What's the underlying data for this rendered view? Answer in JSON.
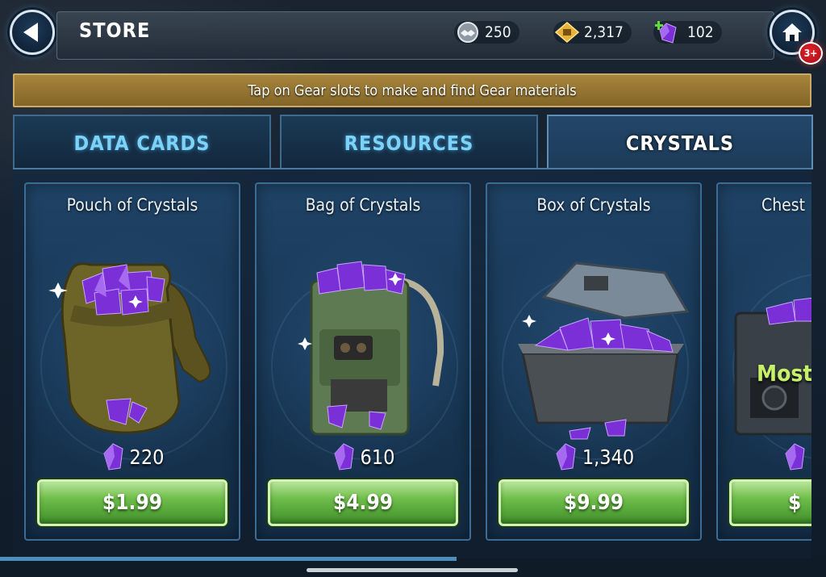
{
  "header": {
    "title": "STORE",
    "currencies": [
      {
        "name": "ally-points",
        "icon": "handshake-icon",
        "value": "250"
      },
      {
        "name": "credits",
        "icon": "credits-icon",
        "value": "2,317"
      },
      {
        "name": "crystals",
        "icon": "crystal-plus-icon",
        "value": "102"
      }
    ],
    "notification_badge": "3+"
  },
  "tip": "Tap on Gear slots to make and find Gear materials",
  "tabs": [
    {
      "label": "DATA CARDS",
      "active": false
    },
    {
      "label": "RESOURCES",
      "active": false
    },
    {
      "label": "CRYSTALS",
      "active": true
    }
  ],
  "products": [
    {
      "title": "Pouch of Crystals",
      "quantity": "220",
      "price": "$1.99",
      "art": "pouch"
    },
    {
      "title": "Bag of Crystals",
      "quantity": "610",
      "price": "$4.99",
      "art": "bag"
    },
    {
      "title": "Box of Crystals",
      "quantity": "1,340",
      "price": "$9.99",
      "art": "box"
    },
    {
      "title": "Chest",
      "quantity": "",
      "price": "$",
      "art": "chest",
      "label": "Most"
    }
  ],
  "colors": {
    "accent_tab_text": "#7cd3f7",
    "price_button": "#6fbd4a",
    "crystal": "#7b2fd6",
    "tip_banner": "#a7853c",
    "badge": "#e3222c"
  }
}
